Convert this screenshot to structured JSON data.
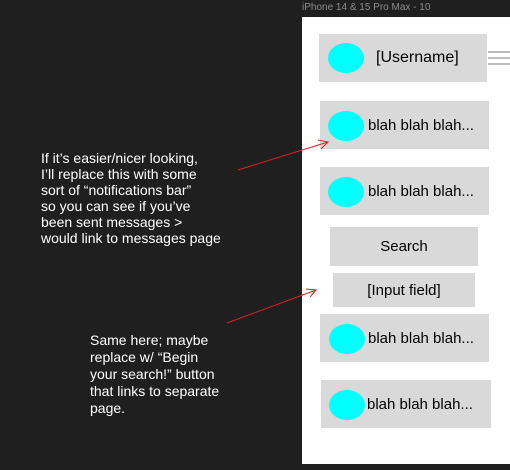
{
  "frame": {
    "title": "iPhone 14 & 15 Pro Max - 10"
  },
  "header": {
    "username": "[Username]"
  },
  "messages": [
    {
      "text": "blah blah blah..."
    },
    {
      "text": "blah blah blah..."
    }
  ],
  "search": {
    "button_label": "Search",
    "input_label": "[Input field]"
  },
  "results": [
    {
      "text": "blah blah blah..."
    },
    {
      "text": "blah blah blah..."
    }
  ],
  "annotations": [
    {
      "lines": [
        "If it’s easier/nicer looking,",
        "I’ll replace this with some",
        "sort of “notifications bar”",
        "so you can see if you’ve",
        "been sent messages >",
        "would link to messages page"
      ]
    },
    {
      "lines": [
        "Same here; maybe",
        "replace w/ “Begin",
        "your search!” button",
        "that links to separate",
        "page."
      ]
    }
  ],
  "colors": {
    "canvas": "#1f1f1f",
    "frame": "#ffffff",
    "card": "#d9d9d9",
    "avatar": "#00ffff",
    "arrow": "#e02020"
  }
}
